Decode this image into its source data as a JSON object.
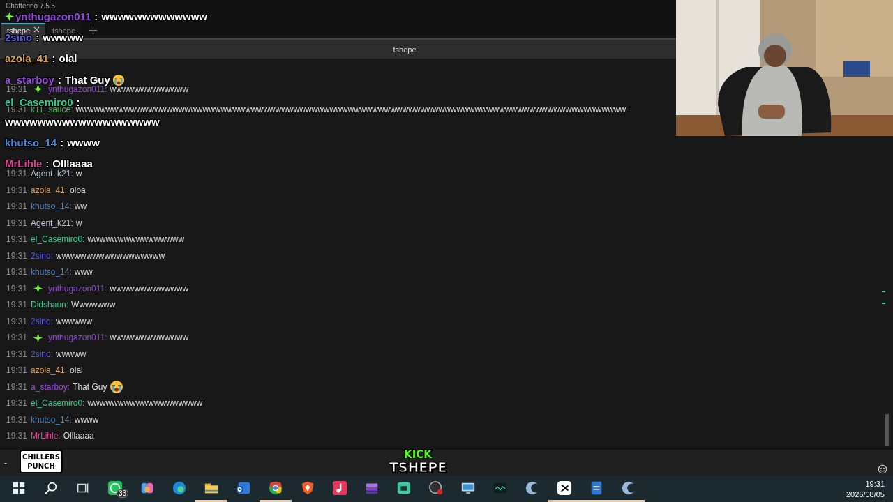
{
  "window": {
    "title": "Chatterino 7.5.5"
  },
  "tabs": [
    {
      "label": "tshepe",
      "selected": true,
      "closable": true
    },
    {
      "label": "tshepe",
      "selected": false,
      "closable": false
    }
  ],
  "split_header": {
    "channel": "tshepe"
  },
  "messages": [
    {
      "time": "19:31",
      "user": "ynthugazon011:",
      "color": "#9146d8",
      "badge": true,
      "text": "wwwwwwwwwwwww",
      "emoji": false
    },
    {
      "time": "19:31",
      "user": "k11_sauce:",
      "color": "#4caf50",
      "badge": false,
      "text": "wwwwwwwwwwwwwwwwwwwwwwwwwwwwwwwwwwwwwwwwwwwwwwwwwwwwwwwwwwwwwwwwwwwwwwwwwwwwwwwwwwwwwwwwwww",
      "emoji": false
    },
    {
      "time": "19:31",
      "user": "Agent_k21:",
      "color": "#b9c6d6",
      "badge": false,
      "text": "w",
      "emoji": false
    },
    {
      "time": "19:31",
      "user": "azola_41:",
      "color": "#daa050",
      "badge": false,
      "text": "oloa",
      "emoji": false
    },
    {
      "time": "19:31",
      "user": "khutso_14:",
      "color": "#4a88d8",
      "badge": false,
      "text": "ww",
      "emoji": false
    },
    {
      "time": "19:31",
      "user": "Agent_k21:",
      "color": "#b9c6d6",
      "badge": false,
      "text": "w",
      "emoji": false
    },
    {
      "time": "19:31",
      "user": "el_Casemiro0:",
      "color": "#2fcf8f",
      "badge": false,
      "text": "wwwwwwwwwwwwwwww",
      "emoji": false
    },
    {
      "time": "19:31",
      "user": "2sino:",
      "color": "#5b5bdb",
      "badge": false,
      "text": "wwwwwwwwwwwwwwwwww",
      "emoji": false
    },
    {
      "time": "19:31",
      "user": "khutso_14:",
      "color": "#4a88d8",
      "badge": false,
      "text": "www",
      "emoji": false
    },
    {
      "time": "19:31",
      "user": "ynthugazon011:",
      "color": "#9146d8",
      "badge": true,
      "text": "wwwwwwwwwwwww",
      "emoji": false
    },
    {
      "time": "19:31",
      "user": "Didshaun:",
      "color": "#40c890",
      "badge": false,
      "text": "Wwwwwww",
      "emoji": false
    },
    {
      "time": "19:31",
      "user": "2sino:",
      "color": "#5b5bdb",
      "badge": false,
      "text": "wwwwww",
      "emoji": false
    },
    {
      "time": "19:31",
      "user": "ynthugazon011:",
      "color": "#9146d8",
      "badge": true,
      "text": "wwwwwwwwwwwww",
      "emoji": false
    },
    {
      "time": "19:31",
      "user": "2sino:",
      "color": "#5b5bdb",
      "badge": false,
      "text": "wwwww",
      "emoji": false
    },
    {
      "time": "19:31",
      "user": "azola_41:",
      "color": "#daa050",
      "badge": false,
      "text": "olal",
      "emoji": false
    },
    {
      "time": "19:31",
      "user": "a_starboy:",
      "color": "#9a4be0",
      "badge": false,
      "text": "That Guy",
      "emoji": true
    },
    {
      "time": "19:31",
      "user": "el_Casemiro0:",
      "color": "#2fcf8f",
      "badge": false,
      "text": "wwwwwwwwwwwwwwwwwww",
      "emoji": false
    },
    {
      "time": "19:31",
      "user": "khutso_14:",
      "color": "#4a88d8",
      "badge": false,
      "text": "wwww",
      "emoji": false
    },
    {
      "time": "19:31",
      "user": "MrLihle:",
      "color": "#e0409a",
      "badge": false,
      "text": "Olllaaaa",
      "emoji": false
    }
  ],
  "overlay_chat": [
    {
      "user": "ynthugazon011",
      "color": "#9146d8",
      "badge": true,
      "separator": ":",
      "text": "wwwwwwwwwwwww",
      "emoji": false
    },
    {
      "user": "2sino",
      "color": "#5b5bdb",
      "badge": false,
      "separator": ":",
      "text": "wwwww",
      "emoji": false
    },
    {
      "user": "azola_41",
      "color": "#daa050",
      "badge": false,
      "separator": ":",
      "text": "olal",
      "emoji": false
    },
    {
      "user": "a_starboy",
      "color": "#9a4be0",
      "badge": false,
      "separator": ":",
      "text": "That Guy",
      "emoji": true
    },
    {
      "user": "el_Casemiro0",
      "color": "#2fcf8f",
      "badge": false,
      "separator": ":",
      "text": "wwwwwwwwwwwwwwwwwww",
      "emoji": false
    },
    {
      "user": "khutso_14",
      "color": "#4a88d8",
      "badge": false,
      "separator": ":",
      "text": "wwww",
      "emoji": false
    },
    {
      "user": "MrLihle",
      "color": "#e0409a",
      "badge": false,
      "separator": ":",
      "text": "Olllaaaa",
      "emoji": false
    }
  ],
  "input": {
    "value": "-"
  },
  "logo_overlay": {
    "lines": [
      "CHILLERS",
      "PUNCH"
    ]
  },
  "stream_overlay": {
    "platform": "KICK",
    "name": "TSHEPE"
  },
  "taskbar": {
    "apps": [
      {
        "kind": "start",
        "running": false
      },
      {
        "kind": "search",
        "running": false
      },
      {
        "kind": "taskview",
        "running": false
      },
      {
        "kind": "chat",
        "running": false,
        "badge": "33"
      },
      {
        "kind": "ribbon",
        "running": false
      },
      {
        "kind": "wave",
        "running": false
      },
      {
        "kind": "folder",
        "running": true
      },
      {
        "kind": "mail",
        "running": false
      },
      {
        "kind": "browser",
        "running": true
      },
      {
        "kind": "shield",
        "running": false
      },
      {
        "kind": "note",
        "running": false
      },
      {
        "kind": "stack",
        "running": false
      },
      {
        "kind": "bot",
        "running": false
      },
      {
        "kind": "record",
        "running": false
      },
      {
        "kind": "monitor",
        "running": false
      },
      {
        "kind": "signal",
        "running": false
      },
      {
        "kind": "crescent",
        "running": false
      },
      {
        "kind": "cut",
        "running": true
      },
      {
        "kind": "document",
        "running": true
      },
      {
        "kind": "crescent",
        "running": true
      }
    ],
    "clock": {
      "time": "19:31",
      "date": "2026/08/05"
    }
  }
}
